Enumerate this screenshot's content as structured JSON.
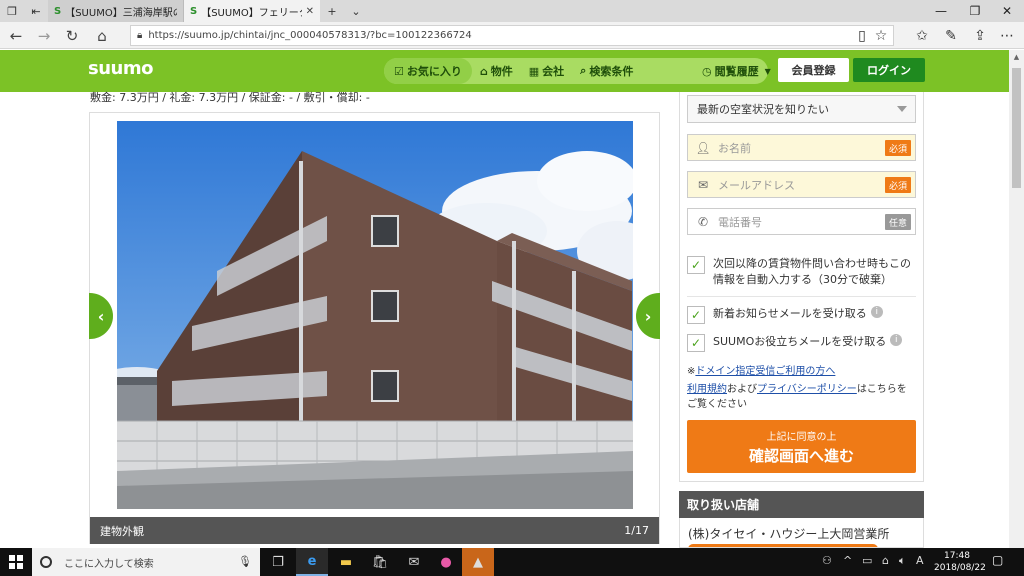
{
  "browser": {
    "tabs": [
      {
        "favicon": "S",
        "title": "【SUUMO】三浦海岸駅の賃貸",
        "active": false
      },
      {
        "favicon": "S",
        "title": "【SUUMO】フェリーク三浦",
        "active": true
      }
    ],
    "new_tab_label": "+",
    "url": "https://suumo.jp/chintai/jnc_000040578313/?bc=100122366724"
  },
  "site": {
    "logo": "suumo",
    "nav": {
      "favorites": "お気に入り",
      "property": "物件",
      "company": "会社",
      "search_conditions": "検索条件",
      "history": "閲覧履歴"
    },
    "register_label": "会員登録",
    "login_label": "ログイン"
  },
  "listing": {
    "fees_line": "敷金: 7.3万円 / 礼金: 7.3万円 / 保証金: - / 敷引・償却: -",
    "gallery": {
      "caption": "建物外観",
      "counter": "1/17"
    }
  },
  "form": {
    "inquiry_type": "最新の空室状況を知りたい",
    "name_placeholder": "お名前",
    "email_placeholder": "メールアドレス",
    "phone_placeholder": "電話番号",
    "required_tag": "必須",
    "optional_tag": "任意",
    "auto_fill_label": "次回以降の賃貸物件問い合わせ時もこの情報を自動入力する（30分で破棄）",
    "newsletter_label": "新着お知らせメールを受け取る",
    "tips_mail_label": "SUUMOお役立ちメールを受け取る",
    "domain_note_prefix": "※",
    "domain_note_link": "ドメイン指定受信ご利用の方へ",
    "terms_link": "利用規約",
    "terms_and": "および",
    "privacy_link": "プライバシーポリシー",
    "terms_suffix": "はこちらをご覧ください",
    "confirm_sub": "上記に同意の上",
    "confirm_main": "確認画面へ進む"
  },
  "dealer": {
    "heading": "取り扱い店舗",
    "name": "(株)タイセイ・ハウジー上大岡営業所"
  },
  "taskbar": {
    "search_placeholder": "ここに入力して検索",
    "time": "17:48",
    "date": "2018/08/22",
    "ime": "A"
  },
  "colors": {
    "brand_green": "#7cc226",
    "login_green": "#1f8a1f",
    "cta_orange": "#ef7a16"
  }
}
